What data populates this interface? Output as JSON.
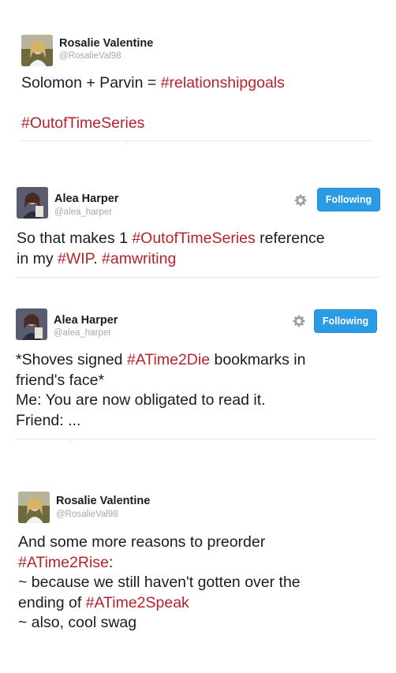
{
  "tweets": [
    {
      "name": "Rosalie Valentine",
      "handle": "@RosalieVal98",
      "lines": [
        [
          {
            "t": "Solomon + Parvin = "
          },
          {
            "t": "#relationshipgoals",
            "tag": true
          }
        ],
        [],
        [
          {
            "t": "#OutofTimeSeries",
            "tag": true
          }
        ]
      ]
    },
    {
      "name": "Alea Harper",
      "handle": "@alea_harper",
      "follow_label": "Following",
      "lines": [
        [
          {
            "t": "So that makes 1 "
          },
          {
            "t": "#OutofTimeSeries",
            "tag": true
          },
          {
            "t": " reference"
          }
        ],
        [
          {
            "t": "in my "
          },
          {
            "t": "#WIP",
            "tag": true
          },
          {
            "t": ". "
          },
          {
            "t": "#amwriting",
            "tag": true
          }
        ]
      ]
    },
    {
      "name": "Alea Harper",
      "handle": "@alea_harper",
      "follow_label": "Following",
      "lines": [
        [
          {
            "t": "*Shoves signed "
          },
          {
            "t": "#ATime2Die",
            "tag": true
          },
          {
            "t": " bookmarks in"
          }
        ],
        [
          {
            "t": "friend's face*"
          }
        ],
        [
          {
            "t": "Me: You are now obligated to read it."
          }
        ],
        [
          {
            "t": "Friend: ..."
          }
        ]
      ]
    },
    {
      "name": "Rosalie Valentine",
      "handle": "@RosalieVal98",
      "lines": [
        [
          {
            "t": "And some more reasons to preorder"
          }
        ],
        [
          {
            "t": "#ATime2Rise",
            "tag": true
          },
          {
            "t": ":"
          }
        ],
        [
          {
            "t": " ~ because we still haven't gotten over the"
          }
        ],
        [
          {
            "t": "ending of "
          },
          {
            "t": "#ATime2Speak",
            "tag": true
          }
        ],
        [
          {
            "t": " ~ also, cool swag"
          }
        ]
      ]
    }
  ],
  "colors": {
    "hashtag": "#b5232b",
    "button": "#2b9be6",
    "handle": "#a3a9ad",
    "divider": "#e6e9eb"
  },
  "icons": [
    "gear-icon"
  ]
}
